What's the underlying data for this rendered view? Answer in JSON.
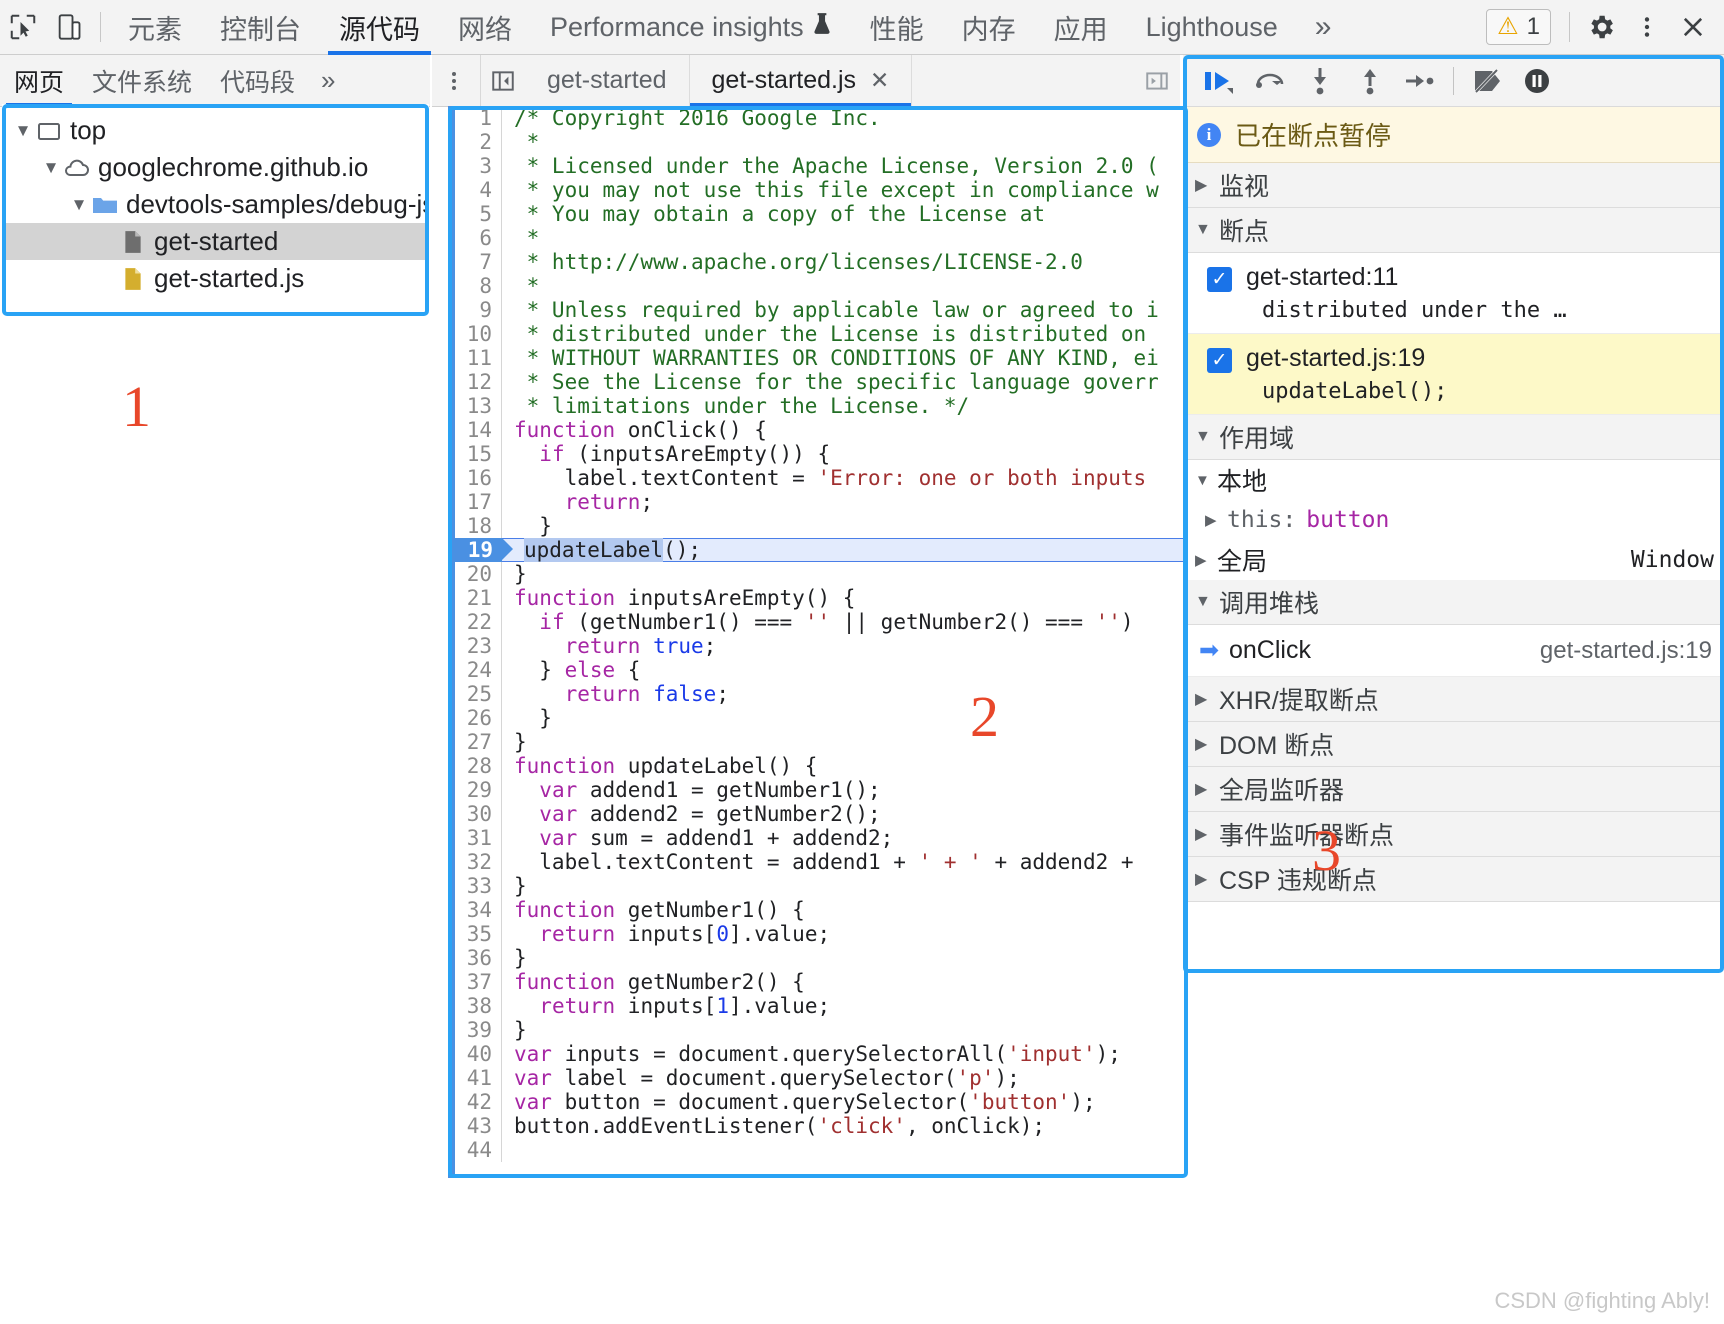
{
  "topbar": {
    "icons": [
      {
        "name": "inspect-element-icon",
        "glyph": "inspect"
      },
      {
        "name": "device-toolbar-icon",
        "glyph": "device"
      }
    ],
    "tabs": [
      {
        "label": "元素",
        "active": false
      },
      {
        "label": "控制台",
        "active": false
      },
      {
        "label": "源代码",
        "active": true
      },
      {
        "label": "网络",
        "active": false
      },
      {
        "label": "Performance insights",
        "active": false,
        "flask": "⚗"
      },
      {
        "label": "性能",
        "active": false
      },
      {
        "label": "内存",
        "active": false
      },
      {
        "label": "应用",
        "active": false
      },
      {
        "label": "Lighthouse",
        "active": false
      }
    ],
    "more_label": "»",
    "warning_count": "1",
    "warning_icon": "⚠",
    "settings_icon": "gear-icon",
    "kebab_icon": "more-vertical-icon",
    "close_icon": "✕"
  },
  "navigator": {
    "tabs": [
      {
        "label": "网页",
        "active": true
      },
      {
        "label": "文件系统",
        "active": false
      },
      {
        "label": "代码段",
        "active": false
      }
    ],
    "more_label": "»",
    "kebab_label": "⋮",
    "tree": [
      {
        "label": "top",
        "depth": 0,
        "icon": "frame-icon",
        "expanded": true,
        "selected": false
      },
      {
        "label": "googlechrome.github.io",
        "depth": 1,
        "icon": "cloud-icon",
        "expanded": true,
        "selected": false
      },
      {
        "label": "devtools-samples/debug-js",
        "depth": 2,
        "icon": "folder-icon",
        "expanded": true,
        "selected": false
      },
      {
        "label": "get-started",
        "depth": 3,
        "icon": "document-icon",
        "expanded": null,
        "selected": true
      },
      {
        "label": "get-started.js",
        "depth": 3,
        "icon": "script-icon",
        "expanded": null,
        "selected": false
      }
    ]
  },
  "editor_tabbar": {
    "kebab_label": "⋮",
    "panel_toggle_icon": "show-navigator-icon",
    "tabs": [
      {
        "label": "get-started",
        "active": false,
        "closable": false
      },
      {
        "label": "get-started.js",
        "active": true,
        "closable": true,
        "close_label": "✕"
      }
    ],
    "collapse_icon": "show-debugger-icon"
  },
  "code": {
    "filename": "get-started.js",
    "highlighted_line": 19,
    "selection_text": "updateLabel",
    "lines": [
      {
        "n": 1,
        "tokens": [
          {
            "t": "/* Copyright 2016 Google Inc.",
            "c": "cm"
          }
        ]
      },
      {
        "n": 2,
        "tokens": [
          {
            "t": " *",
            "c": "cm"
          }
        ]
      },
      {
        "n": 3,
        "tokens": [
          {
            "t": " * Licensed under the Apache License, Version 2.0 (",
            "c": "cm"
          }
        ]
      },
      {
        "n": 4,
        "tokens": [
          {
            "t": " * you may not use this file except in compliance w",
            "c": "cm"
          }
        ]
      },
      {
        "n": 5,
        "tokens": [
          {
            "t": " * You may obtain a copy of the License at",
            "c": "cm"
          }
        ]
      },
      {
        "n": 6,
        "tokens": [
          {
            "t": " *",
            "c": "cm"
          }
        ]
      },
      {
        "n": 7,
        "tokens": [
          {
            "t": " * http://www.apache.org/licenses/LICENSE-2.0",
            "c": "cm"
          }
        ]
      },
      {
        "n": 8,
        "tokens": [
          {
            "t": " *",
            "c": "cm"
          }
        ]
      },
      {
        "n": 9,
        "tokens": [
          {
            "t": " * Unless required by applicable law or agreed to i",
            "c": "cm"
          }
        ]
      },
      {
        "n": 10,
        "tokens": [
          {
            "t": " * distributed under the License is distributed on",
            "c": "cm"
          }
        ]
      },
      {
        "n": 11,
        "tokens": [
          {
            "t": " * WITHOUT WARRANTIES OR CONDITIONS OF ANY KIND, ei",
            "c": "cm"
          }
        ]
      },
      {
        "n": 12,
        "tokens": [
          {
            "t": " * See the License for the specific language goverr",
            "c": "cm"
          }
        ]
      },
      {
        "n": 13,
        "tokens": [
          {
            "t": " * limitations under the License. */",
            "c": "cm"
          }
        ]
      },
      {
        "n": 14,
        "tokens": [
          {
            "t": "function",
            "c": "kw"
          },
          {
            "t": " onClick() {",
            "c": ""
          }
        ]
      },
      {
        "n": 15,
        "tokens": [
          {
            "t": "  ",
            "c": ""
          },
          {
            "t": "if",
            "c": "kw"
          },
          {
            "t": " (inputsAreEmpty()) {",
            "c": ""
          }
        ]
      },
      {
        "n": 16,
        "tokens": [
          {
            "t": "    label.textContent = ",
            "c": ""
          },
          {
            "t": "'Error: one or both inputs",
            "c": "st"
          }
        ]
      },
      {
        "n": 17,
        "tokens": [
          {
            "t": "    ",
            "c": ""
          },
          {
            "t": "return",
            "c": "kw"
          },
          {
            "t": ";",
            "c": ""
          }
        ]
      },
      {
        "n": 18,
        "tokens": [
          {
            "t": "  }",
            "c": ""
          }
        ]
      },
      {
        "n": 19,
        "tokens": [
          {
            "t": "updateLabel",
            "c": "sel"
          },
          {
            "t": "();",
            "c": ""
          }
        ]
      },
      {
        "n": 20,
        "tokens": [
          {
            "t": "}",
            "c": ""
          }
        ]
      },
      {
        "n": 21,
        "tokens": [
          {
            "t": "function",
            "c": "kw"
          },
          {
            "t": " inputsAreEmpty() {",
            "c": ""
          }
        ]
      },
      {
        "n": 22,
        "tokens": [
          {
            "t": "  ",
            "c": ""
          },
          {
            "t": "if",
            "c": "kw"
          },
          {
            "t": " (getNumber1() === ",
            "c": ""
          },
          {
            "t": "''",
            "c": "st"
          },
          {
            "t": " || getNumber2() === ",
            "c": ""
          },
          {
            "t": "''",
            "c": "st"
          },
          {
            "t": ") ",
            "c": ""
          }
        ]
      },
      {
        "n": 23,
        "tokens": [
          {
            "t": "    ",
            "c": ""
          },
          {
            "t": "return",
            "c": "kw"
          },
          {
            "t": " ",
            "c": ""
          },
          {
            "t": "true",
            "c": "nm"
          },
          {
            "t": ";",
            "c": ""
          }
        ]
      },
      {
        "n": 24,
        "tokens": [
          {
            "t": "  } ",
            "c": ""
          },
          {
            "t": "else",
            "c": "kw"
          },
          {
            "t": " {",
            "c": ""
          }
        ]
      },
      {
        "n": 25,
        "tokens": [
          {
            "t": "    ",
            "c": ""
          },
          {
            "t": "return",
            "c": "kw"
          },
          {
            "t": " ",
            "c": ""
          },
          {
            "t": "false",
            "c": "nm"
          },
          {
            "t": ";",
            "c": ""
          }
        ]
      },
      {
        "n": 26,
        "tokens": [
          {
            "t": "  }",
            "c": ""
          }
        ]
      },
      {
        "n": 27,
        "tokens": [
          {
            "t": "}",
            "c": ""
          }
        ]
      },
      {
        "n": 28,
        "tokens": [
          {
            "t": "function",
            "c": "kw"
          },
          {
            "t": " updateLabel() {",
            "c": ""
          }
        ]
      },
      {
        "n": 29,
        "tokens": [
          {
            "t": "  ",
            "c": ""
          },
          {
            "t": "var",
            "c": "kw"
          },
          {
            "t": " addend1 = getNumber1();",
            "c": ""
          }
        ]
      },
      {
        "n": 30,
        "tokens": [
          {
            "t": "  ",
            "c": ""
          },
          {
            "t": "var",
            "c": "kw"
          },
          {
            "t": " addend2 = getNumber2();",
            "c": ""
          }
        ]
      },
      {
        "n": 31,
        "tokens": [
          {
            "t": "  ",
            "c": ""
          },
          {
            "t": "var",
            "c": "kw"
          },
          {
            "t": " sum = addend1 + addend2;",
            "c": ""
          }
        ]
      },
      {
        "n": 32,
        "tokens": [
          {
            "t": "  label.textContent = addend1 + ",
            "c": ""
          },
          {
            "t": "' + '",
            "c": "st"
          },
          {
            "t": " + addend2 + ",
            "c": ""
          }
        ]
      },
      {
        "n": 33,
        "tokens": [
          {
            "t": "}",
            "c": ""
          }
        ]
      },
      {
        "n": 34,
        "tokens": [
          {
            "t": "function",
            "c": "kw"
          },
          {
            "t": " getNumber1() {",
            "c": ""
          }
        ]
      },
      {
        "n": 35,
        "tokens": [
          {
            "t": "  ",
            "c": ""
          },
          {
            "t": "return",
            "c": "kw"
          },
          {
            "t": " inputs[",
            "c": ""
          },
          {
            "t": "0",
            "c": "nm"
          },
          {
            "t": "].value;",
            "c": ""
          }
        ]
      },
      {
        "n": 36,
        "tokens": [
          {
            "t": "}",
            "c": ""
          }
        ]
      },
      {
        "n": 37,
        "tokens": [
          {
            "t": "function",
            "c": "kw"
          },
          {
            "t": " getNumber2() {",
            "c": ""
          }
        ]
      },
      {
        "n": 38,
        "tokens": [
          {
            "t": "  ",
            "c": ""
          },
          {
            "t": "return",
            "c": "kw"
          },
          {
            "t": " inputs[",
            "c": ""
          },
          {
            "t": "1",
            "c": "nm"
          },
          {
            "t": "].value;",
            "c": ""
          }
        ]
      },
      {
        "n": 39,
        "tokens": [
          {
            "t": "}",
            "c": ""
          }
        ]
      },
      {
        "n": 40,
        "tokens": [
          {
            "t": "var",
            "c": "kw"
          },
          {
            "t": " inputs = document.querySelectorAll(",
            "c": ""
          },
          {
            "t": "'input'",
            "c": "st"
          },
          {
            "t": ");",
            "c": ""
          }
        ]
      },
      {
        "n": 41,
        "tokens": [
          {
            "t": "var",
            "c": "kw"
          },
          {
            "t": " label = document.querySelector(",
            "c": ""
          },
          {
            "t": "'p'",
            "c": "st"
          },
          {
            "t": ");",
            "c": ""
          }
        ]
      },
      {
        "n": 42,
        "tokens": [
          {
            "t": "var",
            "c": "kw"
          },
          {
            "t": " button = document.querySelector(",
            "c": ""
          },
          {
            "t": "'button'",
            "c": "st"
          },
          {
            "t": ");",
            "c": ""
          }
        ]
      },
      {
        "n": 43,
        "tokens": [
          {
            "t": "button.addEventListener(",
            "c": ""
          },
          {
            "t": "'click'",
            "c": "st"
          },
          {
            "t": ", onClick);",
            "c": ""
          }
        ]
      },
      {
        "n": 44,
        "tokens": [
          {
            "t": "",
            "c": ""
          }
        ]
      }
    ]
  },
  "debugger": {
    "toolbar": [
      {
        "name": "resume-button",
        "title": "resume"
      },
      {
        "name": "step-over-button",
        "title": "step-over"
      },
      {
        "name": "step-into-button",
        "title": "step-into"
      },
      {
        "name": "step-out-button",
        "title": "step-out"
      },
      {
        "name": "step-button",
        "title": "step"
      },
      {
        "name": "deactivate-breakpoints-button",
        "title": "deactivate-breakpoints"
      },
      {
        "name": "pause-on-exceptions-button",
        "title": "pause-on-exceptions"
      }
    ],
    "paused_message": "已在断点暂停",
    "sections": {
      "watch": {
        "label": "监视",
        "expanded": false
      },
      "breakpoints": {
        "label": "断点",
        "expanded": true
      },
      "scope": {
        "label": "作用域",
        "expanded": true
      },
      "callstack": {
        "label": "调用堆栈",
        "expanded": true
      },
      "xhr": {
        "label": "XHR/提取断点",
        "expanded": false
      },
      "dom": {
        "label": "DOM 断点",
        "expanded": false
      },
      "global_listeners": {
        "label": "全局监听器",
        "expanded": false
      },
      "event_listener": {
        "label": "事件监听器断点",
        "expanded": false
      },
      "csp": {
        "label": "CSP 违规断点",
        "expanded": false
      }
    },
    "breakpoints": [
      {
        "checked": true,
        "location": "get-started:11",
        "snippet": "distributed under the …",
        "hit": false
      },
      {
        "checked": true,
        "location": "get-started.js:19",
        "snippet": "updateLabel();",
        "hit": true
      }
    ],
    "scope": {
      "local_label": "本地",
      "entries": [
        {
          "key": "this:",
          "value": "button",
          "expandable": true
        }
      ],
      "global_label": "全局",
      "global_value": "Window"
    },
    "callstack": [
      {
        "active": true,
        "function": "onClick",
        "location": "get-started.js:19"
      }
    ]
  },
  "annotations": [
    {
      "number": "1"
    },
    {
      "number": "2"
    },
    {
      "number": "3"
    }
  ],
  "watermark": "CSDN @fighting Ably!"
}
